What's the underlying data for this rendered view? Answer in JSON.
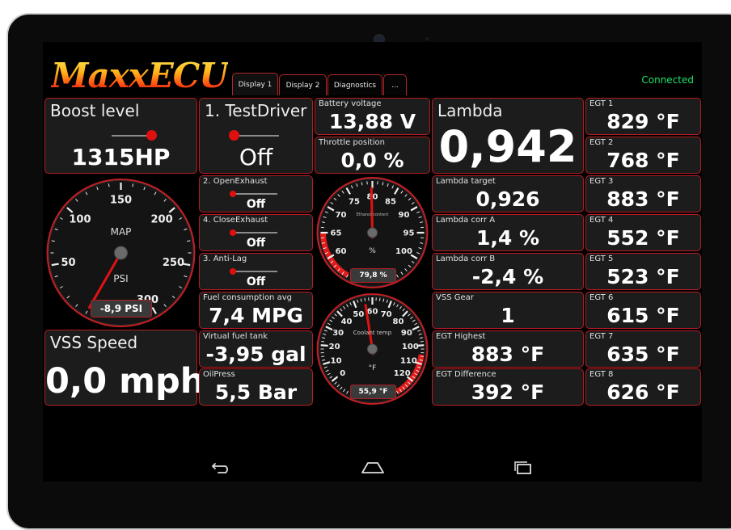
{
  "app": {
    "logo_text": "MaxxECU",
    "status": "Connected"
  },
  "tabs": [
    {
      "label": "Display 1",
      "active": true
    },
    {
      "label": "Display 2",
      "active": false
    },
    {
      "label": "Diagnostics",
      "active": false
    },
    {
      "label": "...",
      "active": false
    }
  ],
  "panels": {
    "boost": {
      "label": "Boost level",
      "value": "1315HP",
      "level": 1.0
    },
    "test_driver": {
      "label": "1. TestDriver",
      "value": "Off",
      "level": 0.0
    },
    "open_exhaust": {
      "label": "2. OpenExhaust",
      "value": "Off",
      "level": 0.0
    },
    "close_exhaust": {
      "label": "4. CloseExhaust",
      "value": "Off",
      "level": 0.0
    },
    "anti_lag": {
      "label": "3. Anti-Lag",
      "value": "Off",
      "level": 0.0
    },
    "battery": {
      "label": "Battery voltage",
      "value": "13,88 V"
    },
    "throttle": {
      "label": "Throttle position",
      "value": "0,0 %"
    },
    "fuel_cons": {
      "label": "Fuel consumption avg",
      "value": "7,4 MPG"
    },
    "fuel_tank": {
      "label": "Virtual fuel tank",
      "value": "-3,95 gal"
    },
    "oil_press": {
      "label": "OilPress",
      "value": "5,5 Bar"
    },
    "vss_speed": {
      "label": "VSS Speed",
      "value": "0,0 mph"
    },
    "lambda": {
      "label": "Lambda",
      "value": "0,942"
    },
    "lambda_target": {
      "label": "Lambda target",
      "value": "0,926"
    },
    "lambda_corr_a": {
      "label": "Lambda corr A",
      "value": "1,4 %"
    },
    "lambda_corr_b": {
      "label": "Lambda corr B",
      "value": "-2,4 %"
    },
    "vss_gear": {
      "label": "VSS Gear",
      "value": "1"
    },
    "egt_highest": {
      "label": "EGT Highest",
      "value": "883 °F"
    },
    "egt_difference": {
      "label": "EGT Difference",
      "value": "392 °F"
    }
  },
  "egt": [
    {
      "label": "EGT 1",
      "value": "829 °F"
    },
    {
      "label": "EGT 2",
      "value": "768 °F"
    },
    {
      "label": "EGT 3",
      "value": "883 °F"
    },
    {
      "label": "EGT 4",
      "value": "552 °F"
    },
    {
      "label": "EGT 5",
      "value": "523 °F"
    },
    {
      "label": "EGT 6",
      "value": "615 °F"
    },
    {
      "label": "EGT 7",
      "value": "635 °F"
    },
    {
      "label": "EGT 8",
      "value": "626 °F"
    }
  ],
  "gauges": {
    "map": {
      "title": "MAP",
      "unit": "PSI",
      "readout": "-8,9 PSI",
      "value": -8.9,
      "min": 0,
      "max": 300,
      "ticks": [
        "50",
        "100",
        "150",
        "200",
        "250",
        "300"
      ]
    },
    "ethanol": {
      "title": "Ethanol content",
      "unit": "%",
      "readout": "79,8 %",
      "value": 79.8,
      "min": 55,
      "max": 105,
      "ticks": [
        "60",
        "65",
        "70",
        "75",
        "80",
        "85",
        "90",
        "95",
        "100"
      ],
      "red_zone": [
        55,
        65
      ]
    },
    "coolant": {
      "title": "Coolant temp",
      "unit": "°F",
      "readout": "55,9 °F",
      "value": 55.9,
      "min": -10,
      "max": 130,
      "ticks": [
        "0",
        "10",
        "20",
        "30",
        "40",
        "50",
        "60",
        "70",
        "80",
        "90",
        "100",
        "110",
        "120"
      ],
      "red_zone": [
        105,
        130
      ]
    }
  },
  "colors": {
    "accent_red": "#b51c22",
    "status_green": "#1ee36b",
    "panel_bg": "#1c1c1c"
  },
  "nav": {
    "icons": [
      "back-icon",
      "home-icon",
      "recent-apps-icon"
    ]
  }
}
